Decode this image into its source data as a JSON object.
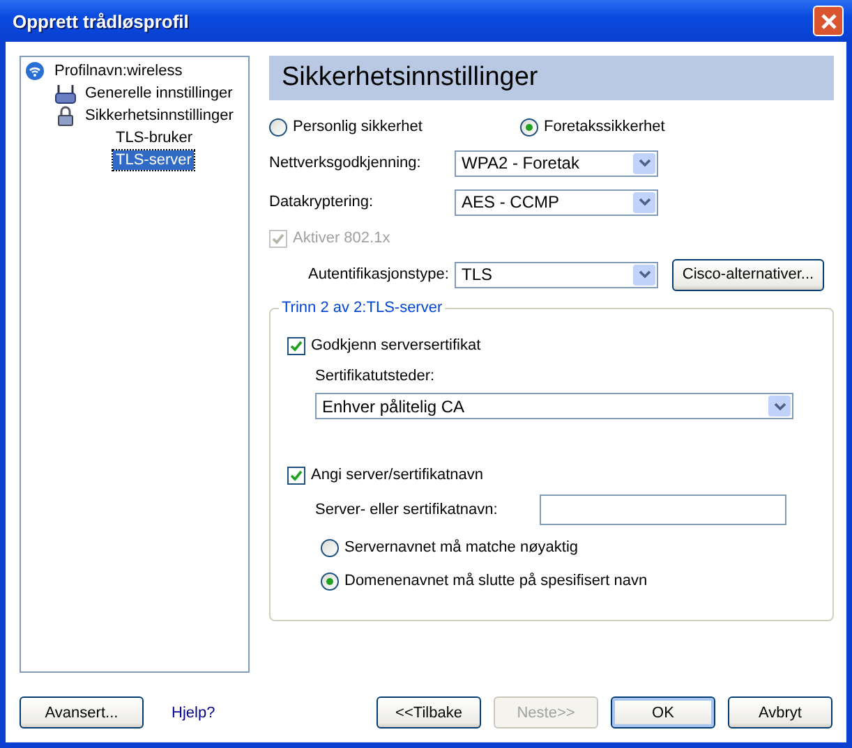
{
  "window": {
    "title": "Opprett trådløsprofil"
  },
  "tree": [
    {
      "label": "Profilnavn:wireless",
      "kind": "wifi",
      "selected": false,
      "children": [
        {
          "label": "Generelle innstillinger",
          "kind": "network",
          "selected": false
        },
        {
          "label": "Sikkerhetsinnstillinger",
          "kind": "lock",
          "selected": false,
          "children": [
            {
              "label": "TLS-bruker",
              "selected": false
            },
            {
              "label": "TLS-server",
              "selected": true
            }
          ]
        }
      ]
    }
  ],
  "header": "Sikkerhetsinnstillinger",
  "security_modes": [
    {
      "label": "Personlig sikkerhet",
      "selected": false
    },
    {
      "label": "Foretakssikkerhet",
      "selected": true
    }
  ],
  "fields": [
    {
      "label": "Nettverksgodkjenning:",
      "value": "WPA2 - Foretak"
    },
    {
      "label": "Datakryptering:",
      "value": "AES - CCMP"
    }
  ],
  "enable_8021x": {
    "label": "Aktiver 802.1x",
    "checked": true,
    "disabled": true
  },
  "auth": {
    "label": "Autentifikasjonstype:",
    "value": "TLS",
    "button": "Cisco-alternativer..."
  },
  "group": {
    "title": "Trinn 2 av 2:TLS-server",
    "validate": {
      "label": "Godkjenn serversertifikat",
      "checked": true
    },
    "issuer_label": "Sertifikatutsteder:",
    "issuer_value": "Enhver pålitelig CA",
    "specify": {
      "label": "Angi server/sertifikatnavn",
      "checked": true
    },
    "name_label": "Server- eller sertifikatnavn:",
    "match_modes": [
      {
        "label": "Servernavnet må matche nøyaktig",
        "selected": false
      },
      {
        "label": "Domenenavnet må slutte på spesifisert navn",
        "selected": true
      }
    ]
  },
  "footer": {
    "advanced": "Avansert...",
    "help": "Hjelp?",
    "buttons": [
      {
        "label": "<<Tilbake",
        "disabled": false,
        "default": false
      },
      {
        "label": "Neste>>",
        "disabled": true,
        "default": false
      },
      {
        "label": "OK",
        "disabled": false,
        "default": true
      },
      {
        "label": "Avbryt",
        "disabled": false,
        "default": false
      }
    ]
  }
}
